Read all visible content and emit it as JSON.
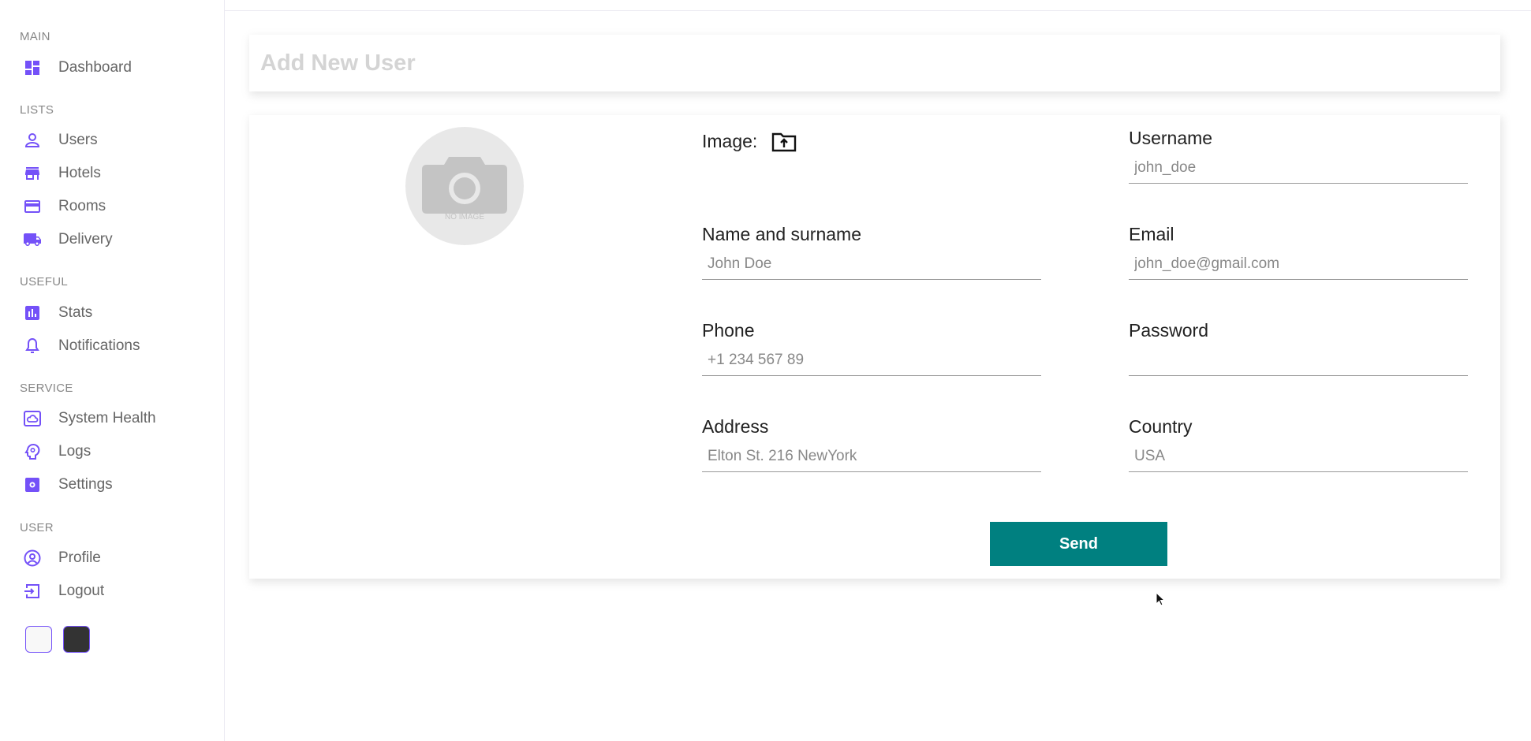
{
  "sidebar": {
    "sections": {
      "main": "MAIN",
      "lists": "LISTS",
      "useful": "USEFUL",
      "service": "SERVICE",
      "user": "USER"
    },
    "items": {
      "dashboard": "Dashboard",
      "users": "Users",
      "hotels": "Hotels",
      "rooms": "Rooms",
      "delivery": "Delivery",
      "stats": "Stats",
      "notifications": "Notifications",
      "system_health": "System Health",
      "logs": "Logs",
      "settings": "Settings",
      "profile": "Profile",
      "logout": "Logout"
    },
    "icons": {
      "dashboard": "dashboard-icon",
      "users": "person-icon",
      "hotels": "store-icon",
      "rooms": "credit-card-icon",
      "delivery": "truck-icon",
      "stats": "bar-chart-icon",
      "notifications": "bell-icon",
      "system_health": "cloud-icon",
      "logs": "psychology-icon",
      "settings": "settings-icon",
      "profile": "account-circle-icon",
      "logout": "exit-icon"
    },
    "accent_color": "#7451f8"
  },
  "header": {
    "title": "Add New User"
  },
  "form": {
    "image_label": "Image:",
    "avatar_text": "NO IMAGE",
    "fields": {
      "username": {
        "label": "Username",
        "placeholder": "john_doe"
      },
      "name": {
        "label": "Name and surname",
        "placeholder": "John Doe"
      },
      "email": {
        "label": "Email",
        "placeholder": "john_doe@gmail.com"
      },
      "phone": {
        "label": "Phone",
        "placeholder": "+1 234 567 89"
      },
      "password": {
        "label": "Password",
        "placeholder": ""
      },
      "address": {
        "label": "Address",
        "placeholder": "Elton St. 216 NewYork"
      },
      "country": {
        "label": "Country",
        "placeholder": "USA"
      }
    },
    "send_label": "Send",
    "send_color": "#008080"
  }
}
